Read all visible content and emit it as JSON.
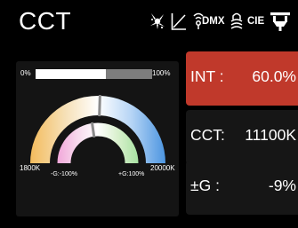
{
  "header": {
    "title": "CCT",
    "icons": [
      {
        "name": "effects-icon"
      },
      {
        "name": "curve-icon"
      },
      {
        "name": "dmx-icon",
        "text": "DMX"
      },
      {
        "name": "lock-icon"
      },
      {
        "name": "cie-icon",
        "text": "CIE"
      },
      {
        "name": "power-icon"
      }
    ]
  },
  "intensity_bar": {
    "min_label": "0%",
    "max_label": "100%",
    "level": 0.6
  },
  "cct_arc": {
    "min_label": "1800K",
    "max_label": "20000K",
    "level": 0.51,
    "colors": [
      "#f3bb5c",
      "#f6dfb4",
      "#ffffff",
      "#b5d4f5",
      "#4c95e0"
    ]
  },
  "green_arc": {
    "min_label": "-G:-100%",
    "max_label": "+G:100%",
    "level": 0.455,
    "colors": [
      "#f1a6d9",
      "#f7d8ec",
      "#ffffff",
      "#d9f0cd",
      "#a9e2a3"
    ]
  },
  "params": {
    "int": {
      "label": "INT  :",
      "value": "60.0%",
      "active_color": "#c0392b"
    },
    "cct": {
      "label": "CCT:",
      "value": "11100K"
    },
    "g": {
      "label": "±G   :",
      "value": "-9%"
    }
  }
}
